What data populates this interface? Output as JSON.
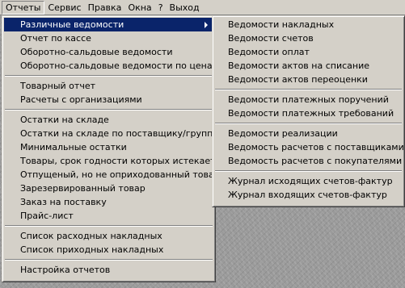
{
  "menubar": {
    "items": [
      {
        "label": "Отчеты"
      },
      {
        "label": "Сервис"
      },
      {
        "label": "Правка"
      },
      {
        "label": "Окна"
      },
      {
        "label": "?"
      },
      {
        "label": "Выход"
      }
    ]
  },
  "reports_menu": {
    "group1": [
      "Различные ведомости",
      "Отчет по кассе",
      "Оборотно-сальдовые ведомости",
      "Оборотно-сальдовые ведомости по ценам"
    ],
    "group2": [
      "Товарный отчет",
      "Расчеты с организациями"
    ],
    "group3": [
      "Остатки на складе",
      "Остатки на складе по поставщику/группе",
      "Минимальные остатки",
      "Товары, срок годности которых истекает",
      "Отпущеный, но не оприходованный товар",
      "Зарезервированный товар",
      "Заказ на поставку",
      "Прайс-лист"
    ],
    "group4": [
      "Список расходных накладных",
      "Список приходных накладных"
    ],
    "group5": [
      "Настройка отчетов"
    ]
  },
  "statements_submenu": {
    "group1": [
      "Ведомости накладных",
      "Ведомости счетов",
      "Ведомости оплат",
      "Ведомости актов на списание",
      "Ведомости актов переоценки"
    ],
    "group2": [
      "Ведомости платежных поручений",
      "Ведомости платежных требований"
    ],
    "group3": [
      "Ведомости реализации",
      "Ведомость расчетов с поставщиками",
      "Ведомость расчетов с покупателями"
    ],
    "group4": [
      "Журнал исходящих счетов-фактур",
      "Журнал входящих счетов-фактур"
    ]
  },
  "colors": {
    "menu_face": "#d4d0c8",
    "highlight": "#0a246a",
    "highlight_text": "#ffffff"
  }
}
